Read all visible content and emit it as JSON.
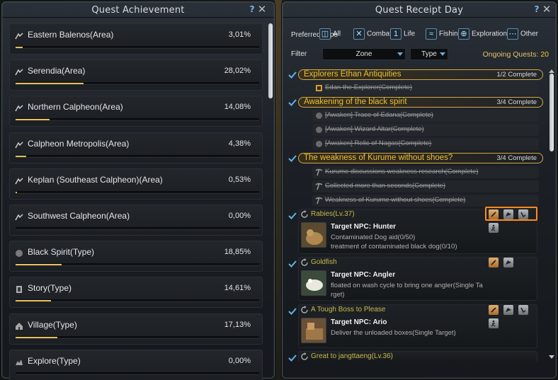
{
  "left_window": {
    "title": "Quest Achievement",
    "items": [
      {
        "name": "Eastern Balenos(Area)",
        "percent": "3,01%",
        "progress": 0.0301,
        "icon": "area-icon"
      },
      {
        "name": "Serendia(Area)",
        "percent": "28,02%",
        "progress": 0.2802,
        "icon": "area-icon"
      },
      {
        "name": "Northern Calpheon(Area)",
        "percent": "14,08%",
        "progress": 0.1408,
        "icon": "area-icon"
      },
      {
        "name": "Calpheon Metropolis(Area)",
        "percent": "4,38%",
        "progress": 0.0438,
        "icon": "area-icon"
      },
      {
        "name": "Keplan (Southeast Calpheon)(Area)",
        "percent": "0,53%",
        "progress": 0.0053,
        "icon": "area-icon"
      },
      {
        "name": "Southwest Calpheon(Area)",
        "percent": "0,00%",
        "progress": 0.0,
        "icon": "area-icon"
      },
      {
        "name": "Black Spirit(Type)",
        "percent": "18,85%",
        "progress": 0.1885,
        "icon": "black-spirit-icon"
      },
      {
        "name": "Story(Type)",
        "percent": "14,61%",
        "progress": 0.1461,
        "icon": "story-icon"
      },
      {
        "name": "Village(Type)",
        "percent": "17,13%",
        "progress": 0.1713,
        "icon": "village-icon"
      },
      {
        "name": "Explore(Type)",
        "percent": "0,00%",
        "progress": 0.0,
        "icon": "explore-icon"
      }
    ]
  },
  "right_window": {
    "title": "Quest Receipt Day",
    "preferred_label": "Preferred Type",
    "preferred_options": [
      {
        "label": "All",
        "icon": "all-icon"
      },
      {
        "label": "Combat",
        "icon": "combat-icon"
      },
      {
        "label": "Life",
        "icon": "life-icon"
      },
      {
        "label": "Fishing",
        "icon": "fishing-icon"
      },
      {
        "label": "Exploration",
        "icon": "exploration-icon"
      },
      {
        "label": "Other",
        "icon": "other-icon"
      }
    ],
    "filter_label": "Filter",
    "zone_dropdown": "Zone",
    "type_dropdown": "Type",
    "ongoing_label": "Ongoing Quests:",
    "ongoing_count": "20",
    "groups": [
      {
        "title": "Explorers Ethan Antiquities",
        "status": "1/2 Complete",
        "subs": [
          "Edan the Explorer(Complete)"
        ]
      },
      {
        "title": "Awakening of the black spirit",
        "status": "3/4 Complete",
        "subs": [
          "[Awaken] Trace of Edana(Complete)",
          "[Awaken] Wizard Altar(Complete)",
          "[Awaken] Relic of Nagas(Complete)"
        ]
      },
      {
        "title": "The weakness of Kurume without shoes?",
        "status": "3/4 Complete",
        "subs": [
          "Kurume discussions weakness research(Complete)",
          "Collected more than seconds(Complete)",
          "Weakness of Kurume without shoes(Complete)"
        ]
      }
    ],
    "quests": [
      {
        "title": "Rabies",
        "level": "(Lv.37)",
        "npc": "Target NPC: Hunter",
        "desc1": "Contaminated Dog aid(0/50)",
        "desc2": "treatment of contaminated black dog(0/10)"
      },
      {
        "title": "Goldfish",
        "level": "",
        "npc": "Target NPC: Angler",
        "desc1": "floated on wash cycle to bring one angler(Single Ta",
        "desc2": "rget)"
      },
      {
        "title": "A Tough Boss to Please",
        "level": "",
        "npc": "Target NPC: Ario",
        "desc1": "Deliver the unloaded boxes(Single Target)",
        "desc2": ""
      },
      {
        "title": "Great to jangttaeng",
        "level": "(Lv.36)",
        "npc": "",
        "desc1": "",
        "desc2": ""
      }
    ]
  },
  "colors": {
    "accent_gold": "#f0c030",
    "highlight_orange": "#ff8a1f",
    "help_blue": "#7fb6e0"
  }
}
